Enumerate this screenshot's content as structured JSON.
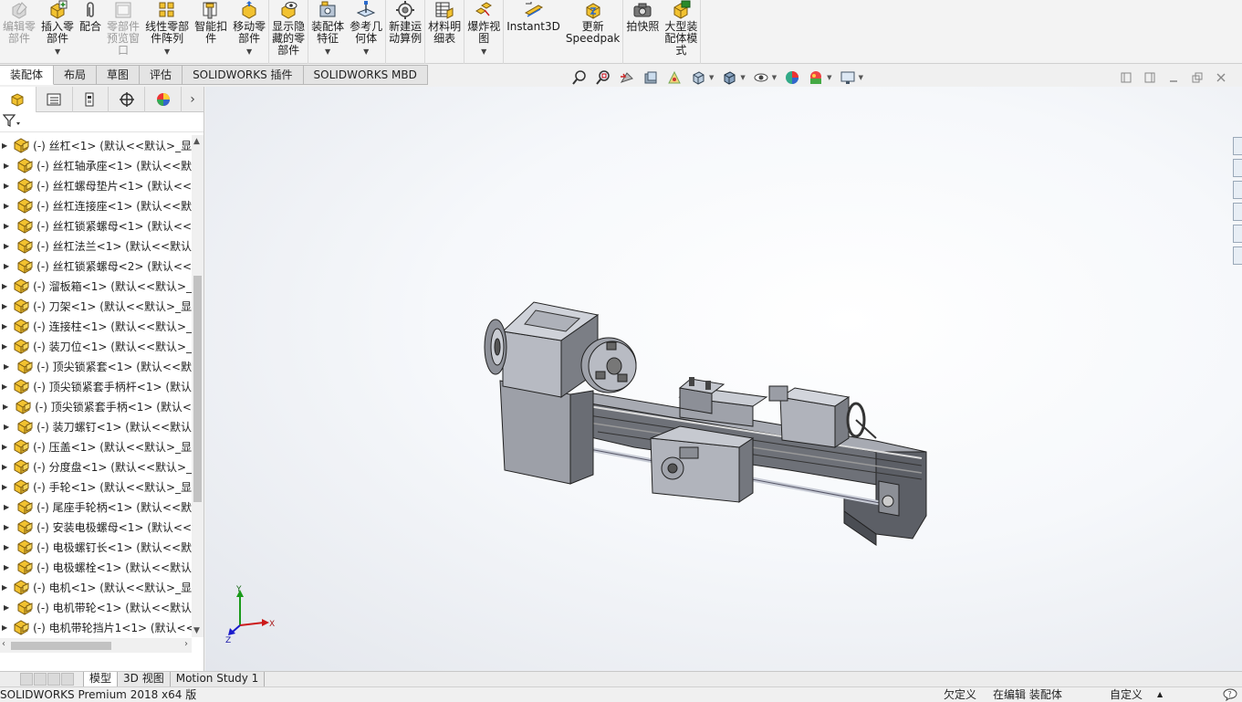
{
  "ribbon": {
    "groups": [
      [
        {
          "name": "edit-component-button",
          "icon": "edit-component-icon",
          "label": "编辑零\n部件",
          "disabled": true,
          "caret": false
        },
        {
          "name": "insert-component-button",
          "icon": "insert-component-icon",
          "label": "插入零\n部件",
          "disabled": false,
          "caret": true
        },
        {
          "name": "mate-button",
          "icon": "mate-paperclip-icon",
          "label": "配合",
          "disabled": false,
          "caret": false
        },
        {
          "name": "component-preview-button",
          "icon": "component-preview-icon",
          "label": "零部件\n预览窗\n口",
          "disabled": true,
          "caret": false
        },
        {
          "name": "linear-pattern-button",
          "icon": "linear-pattern-icon",
          "label": "线性零部\n件阵列",
          "disabled": false,
          "caret": true
        },
        {
          "name": "smart-fasteners-button",
          "icon": "smart-fastener-icon",
          "label": "智能扣\n件",
          "disabled": false,
          "caret": false
        },
        {
          "name": "move-component-button",
          "icon": "move-component-icon",
          "label": "移动零\n部件",
          "disabled": false,
          "caret": true
        }
      ],
      [
        {
          "name": "show-hidden-button",
          "icon": "show-hidden-icon",
          "label": "显示隐\n藏的零\n部件",
          "disabled": false,
          "caret": false
        }
      ],
      [
        {
          "name": "assembly-features-button",
          "icon": "assembly-feature-icon",
          "label": "装配体\n特征",
          "disabled": false,
          "caret": true
        },
        {
          "name": "reference-geometry-button",
          "icon": "reference-geometry-icon",
          "label": "参考几\n何体",
          "disabled": false,
          "caret": true
        }
      ],
      [
        {
          "name": "new-motion-study-button",
          "icon": "motion-study-icon",
          "label": "新建运\n动算例",
          "disabled": false,
          "caret": false
        }
      ],
      [
        {
          "name": "bom-button",
          "icon": "bom-table-icon",
          "label": "材料明\n细表",
          "disabled": false,
          "caret": false
        }
      ],
      [
        {
          "name": "exploded-view-button",
          "icon": "exploded-view-icon",
          "label": "爆炸视\n图",
          "disabled": false,
          "caret": true
        }
      ],
      [
        {
          "name": "instant3d-button",
          "icon": "instant3d-icon",
          "label": "Instant3D",
          "disabled": false,
          "caret": false
        },
        {
          "name": "update-speedpak-button",
          "icon": "speedpak-icon",
          "label": "更新\nSpeedpak",
          "disabled": false,
          "caret": false
        }
      ],
      [
        {
          "name": "take-snapshot-button",
          "icon": "camera-icon",
          "label": "拍快照",
          "disabled": false,
          "caret": false
        },
        {
          "name": "large-assembly-mode-button",
          "icon": "large-assembly-icon",
          "label": "大型装\n配体模\n式",
          "disabled": false,
          "caret": false
        }
      ]
    ]
  },
  "command_tabs": [
    {
      "label": "装配体",
      "active": true
    },
    {
      "label": "布局",
      "active": false
    },
    {
      "label": "草图",
      "active": false
    },
    {
      "label": "评估",
      "active": false
    },
    {
      "label": "SOLIDWORKS 插件",
      "active": false
    },
    {
      "label": "SOLIDWORKS MBD",
      "active": false
    }
  ],
  "tree": {
    "items": [
      "(-) 丝杠<1> (默认<<默认>_显",
      "(-) 丝杠轴承座<1> (默认<<默",
      "(-) 丝杠螺母垫片<1> (默认<<",
      "(-) 丝杠连接座<1> (默认<<默",
      "(-) 丝杠锁紧螺母<1> (默认<<",
      "(-) 丝杠法兰<1> (默认<<默认",
      "(-) 丝杠锁紧螺母<2> (默认<<",
      "(-) 溜板箱<1> (默认<<默认>_",
      "(-) 刀架<1> (默认<<默认>_显",
      "(-) 连接柱<1> (默认<<默认>_",
      "(-) 装刀位<1> (默认<<默认>_",
      "(-) 顶尖锁紧套<1> (默认<<默",
      "(-) 顶尖锁紧套手柄杆<1> (默认",
      "(-) 顶尖锁紧套手柄<1> (默认<",
      "(-) 装刀螺钉<1> (默认<<默认",
      "(-) 压盖<1> (默认<<默认>_显",
      "(-) 分度盘<1> (默认<<默认>_",
      "(-) 手轮<1> (默认<<默认>_显",
      "(-) 尾座手轮柄<1> (默认<<默",
      "(-) 安装电极螺母<1> (默认<<",
      "(-) 电极螺钉长<1> (默认<<默",
      "(-) 电极螺栓<1> (默认<<默认",
      "(-) 电机<1> (默认<<默认>_显",
      "(-) 电机带轮<1> (默认<<默认",
      "(-) 电机带轮挡片1<1> (默认<<"
    ]
  },
  "triad": {
    "x": "X",
    "y": "Y",
    "z": "Z"
  },
  "bottom_tabs": [
    {
      "label": "模型",
      "active": true
    },
    {
      "label": "3D 视图",
      "active": false
    },
    {
      "label": "Motion Study 1",
      "active": false
    }
  ],
  "status": {
    "app": "SOLIDWORKS Premium 2018 x64 版",
    "state1": "欠定义",
    "state2": "在编辑 装配体",
    "units": "自定义"
  }
}
